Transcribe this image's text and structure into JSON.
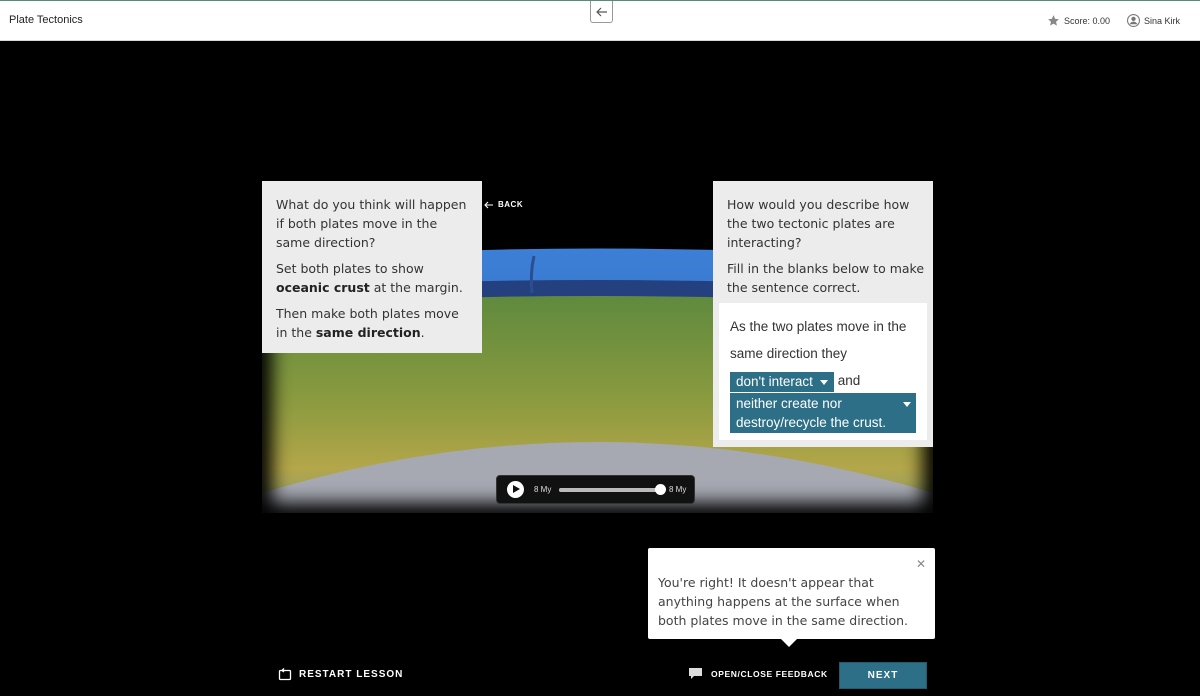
{
  "app": {
    "title": "Plate Tectonics"
  },
  "header": {
    "score_label": "Score: 0.00",
    "user_name": "Sina Kirk"
  },
  "back_label": "BACK",
  "left_card": {
    "question": "What do you think will happen if both plates move in the same direction?",
    "instruction1_pre": "Set both plates to show ",
    "instruction1_bold": "oceanic crust",
    "instruction1_post": " at the margin.",
    "instruction2_pre": "Then make both plates move in the ",
    "instruction2_bold": "same direction",
    "instruction2_post": "."
  },
  "right_card": {
    "question": "How would you describe how the two tectonic plates are interacting?",
    "instruction": "Fill in the blanks below to make the sentence correct.",
    "sentence_start": "As the two plates move in the same direction they",
    "select1_value": "don't interact",
    "connector": "and",
    "select2_value": "neither create nor destroy/recycle the crust."
  },
  "timeline": {
    "start_label": "8 My",
    "end_label": "8 My",
    "progress": 0.98
  },
  "feedback": {
    "message": "You're right! It doesn't appear that anything happens at the surface when both plates move in the same direction."
  },
  "footer": {
    "restart_label": "RESTART LESSON",
    "open_feedback_label": "OPEN/CLOSE FEEDBACK",
    "next_label": "NEXT"
  },
  "colors": {
    "accent": "#2c6f86",
    "card_bg": "#ececec",
    "background": "#000000"
  }
}
